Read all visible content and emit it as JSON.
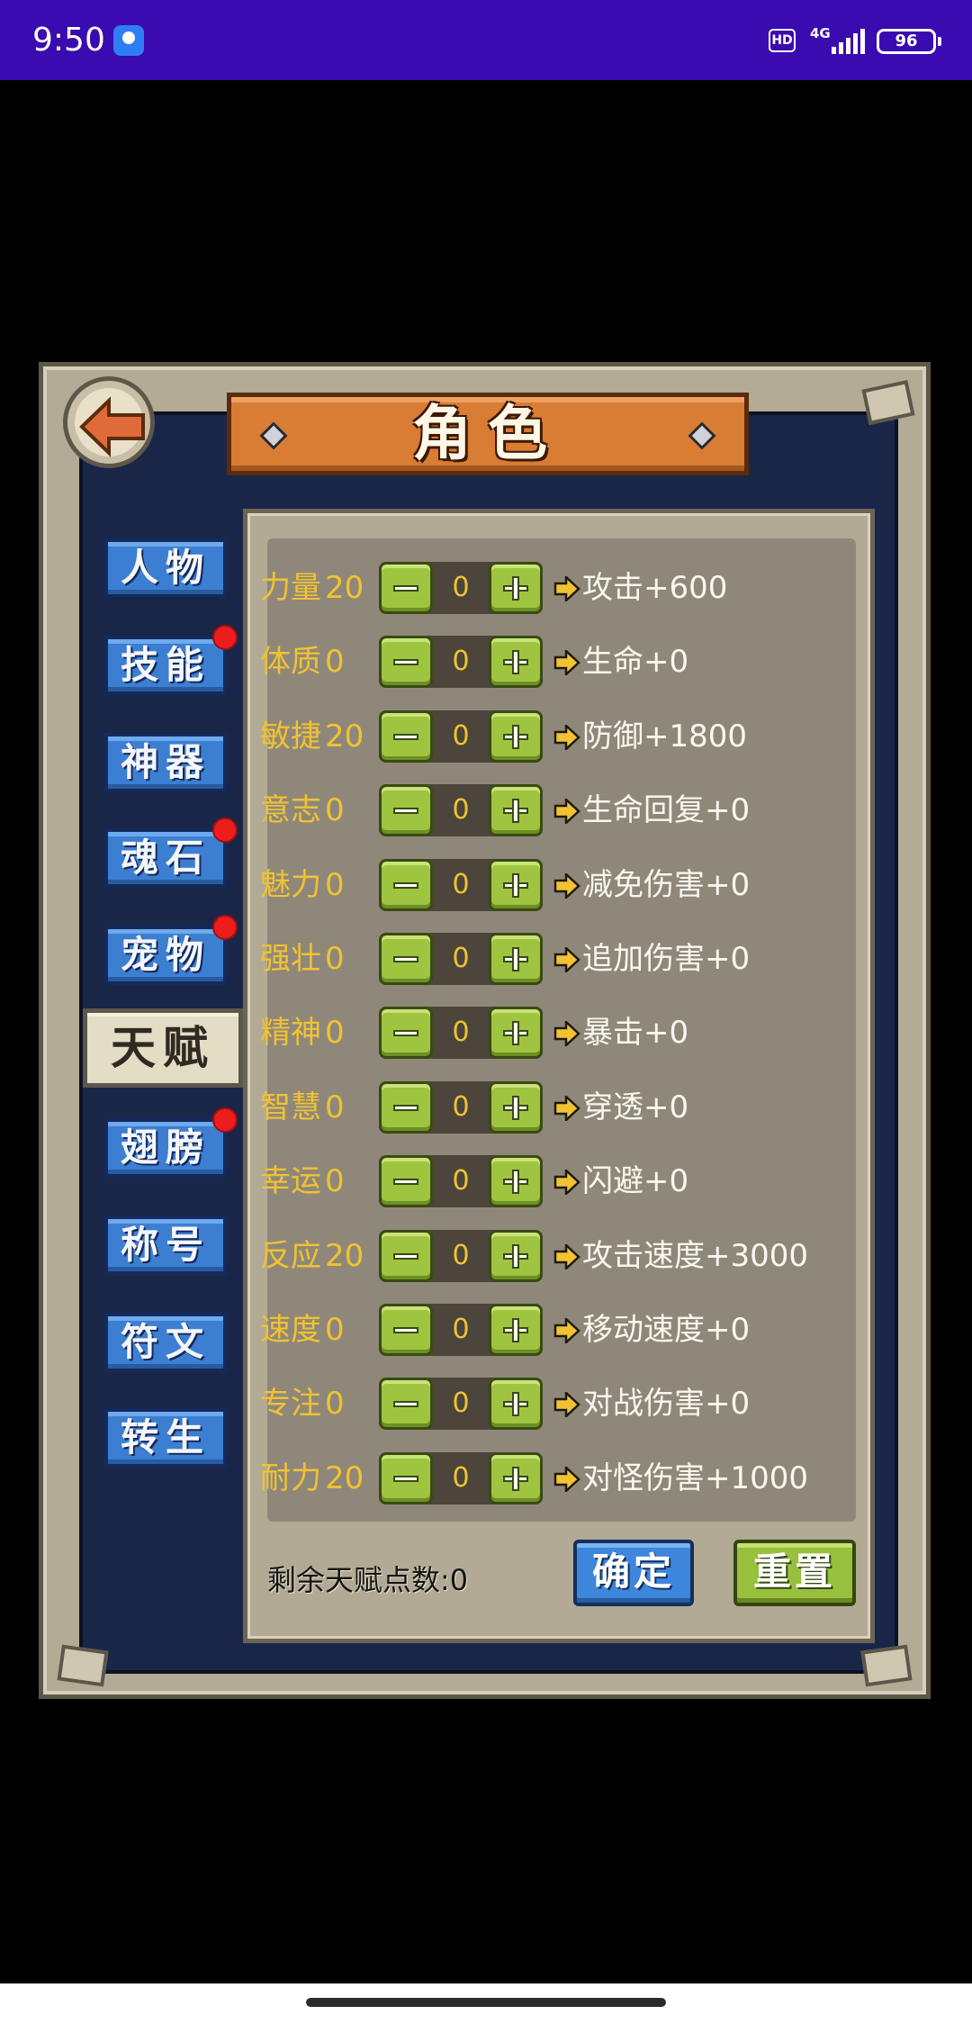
{
  "status_bar": {
    "time": "9:50",
    "hd": "HD",
    "network": "4G",
    "battery": "96"
  },
  "header": {
    "title": "角色"
  },
  "tabs": [
    {
      "label": "人物",
      "badge": false,
      "active": false
    },
    {
      "label": "技能",
      "badge": true,
      "active": false
    },
    {
      "label": "神器",
      "badge": false,
      "active": false
    },
    {
      "label": "魂石",
      "badge": true,
      "active": false
    },
    {
      "label": "宠物",
      "badge": true,
      "active": false
    },
    {
      "label": "天赋",
      "badge": false,
      "active": true
    },
    {
      "label": "翅膀",
      "badge": true,
      "active": false
    },
    {
      "label": "称号",
      "badge": false,
      "active": false
    },
    {
      "label": "符文",
      "badge": false,
      "active": false
    },
    {
      "label": "转生",
      "badge": false,
      "active": false
    }
  ],
  "stats": [
    {
      "name": "力量",
      "value": "20",
      "points": "0",
      "effect": "攻击+600"
    },
    {
      "name": "体质",
      "value": "0",
      "points": "0",
      "effect": "生命+0"
    },
    {
      "name": "敏捷",
      "value": "20",
      "points": "0",
      "effect": "防御+1800"
    },
    {
      "name": "意志",
      "value": "0",
      "points": "0",
      "effect": "生命回复+0"
    },
    {
      "name": "魅力",
      "value": "0",
      "points": "0",
      "effect": "减免伤害+0"
    },
    {
      "name": "强壮",
      "value": "0",
      "points": "0",
      "effect": "追加伤害+0"
    },
    {
      "name": "精神",
      "value": "0",
      "points": "0",
      "effect": "暴击+0"
    },
    {
      "name": "智慧",
      "value": "0",
      "points": "0",
      "effect": "穿透+0"
    },
    {
      "name": "幸运",
      "value": "0",
      "points": "0",
      "effect": "闪避+0"
    },
    {
      "name": "反应",
      "value": "20",
      "points": "0",
      "effect": "攻击速度+3000"
    },
    {
      "name": "速度",
      "value": "0",
      "points": "0",
      "effect": "移动速度+0"
    },
    {
      "name": "专注",
      "value": "0",
      "points": "0",
      "effect": "对战伤害+0"
    },
    {
      "name": "耐力",
      "value": "20",
      "points": "0",
      "effect": "对怪伤害+1000"
    }
  ],
  "footer": {
    "remaining_label": "剩余天赋点数:0",
    "confirm": "确定",
    "reset": "重置"
  },
  "colors": {
    "status_bar": "#3a0bb0",
    "tab_blue": "#3c7fd2",
    "stat_name": "#f1c232",
    "plus_minus_green": "#9fc440",
    "badge_red": "#ee1d1d"
  }
}
